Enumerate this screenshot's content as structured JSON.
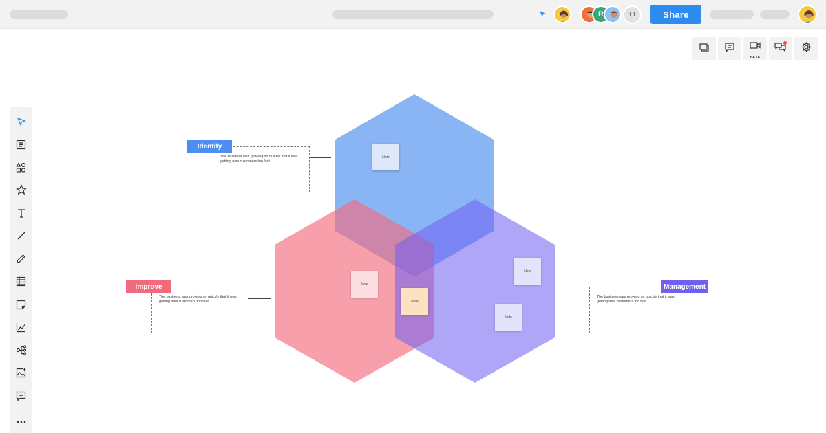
{
  "topbar": {
    "share_label": "Share",
    "extra_collaborators": "+1",
    "collaborator_initial": "R"
  },
  "right_toolbar": {
    "beta_label": "BETA",
    "icons": [
      "frames-icon",
      "comments-icon",
      "video-icon",
      "chat-icon",
      "settings-icon"
    ]
  },
  "left_toolbar": {
    "icons": [
      "select-cursor-icon",
      "template-icon",
      "shapes-icon",
      "star-icon",
      "text-icon",
      "line-icon",
      "pen-icon",
      "table-icon",
      "sticky-note-icon",
      "chart-icon",
      "mindmap-icon",
      "image-icon",
      "add-comment-icon",
      "more-icon"
    ]
  },
  "diagram": {
    "colors": {
      "identify": "#4d8ef0",
      "improve": "#f26b7d",
      "management": "#7060f0"
    },
    "labels": {
      "identify": "Identify",
      "improve": "Improve",
      "management": "Management"
    },
    "descriptions": {
      "identify": "The business was growing so quickly that it was getting new customers too fast.",
      "improve": "The business was growing so quickly that it was getting new customers too fast.",
      "management": "The business was growing so quickly that it was getting new customers too fast."
    },
    "notes": [
      "Note",
      "Note",
      "Note",
      "Note",
      "Note"
    ]
  }
}
